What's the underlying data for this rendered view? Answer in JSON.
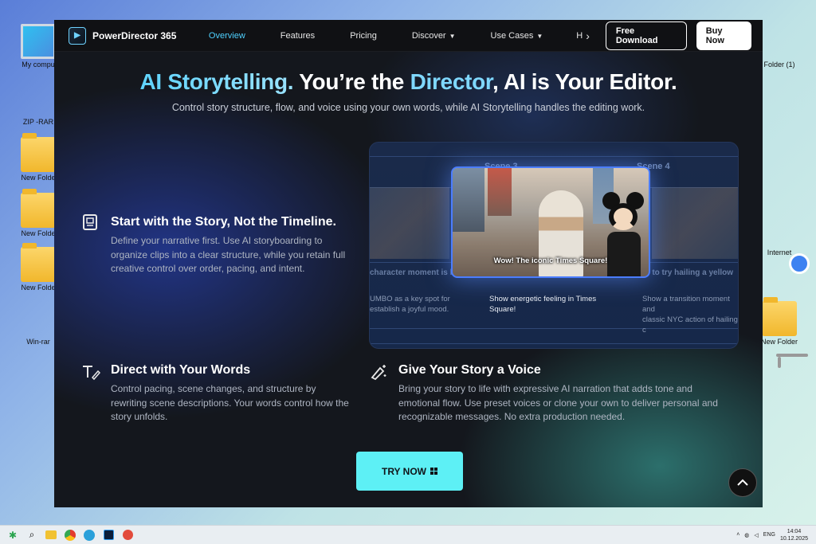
{
  "desktop": {
    "left_icons": [
      {
        "label": "My compu",
        "icon": "computer-icon"
      },
      {
        "label": "ZIP -RAR",
        "icon": "binders-icon"
      },
      {
        "label": "New Folde",
        "icon": "folder-icon"
      },
      {
        "label": "New Folde",
        "icon": "folder-icon"
      },
      {
        "label": "New Folde",
        "icon": "folder-icon"
      },
      {
        "label": "Win-rar",
        "icon": "winrar-icon"
      }
    ],
    "right_icons": [
      {
        "label": "Folder (1)",
        "icon": "binders-icon"
      },
      {
        "label": "Internet",
        "icon": "chrome-icon"
      },
      {
        "label": "New Folder",
        "icon": "folder-icon"
      },
      {
        "label": "",
        "icon": "recycle-bin-icon"
      }
    ]
  },
  "nav": {
    "brand": "PowerDirector 365",
    "links": [
      {
        "label": "Overview",
        "active": true
      },
      {
        "label": "Features"
      },
      {
        "label": "Pricing"
      },
      {
        "label": "Discover",
        "dropdown": true
      },
      {
        "label": "Use Cases",
        "dropdown": true
      },
      {
        "label": "H"
      }
    ],
    "arrow": "›",
    "free_download": "Free Download",
    "buy_now": "Buy Now"
  },
  "hero": {
    "title_part1": "AI Storytelling.",
    "title_part2": " You’re the ",
    "title_part3": "Director",
    "title_part4": ", AI is Your Editor.",
    "subtitle": "Control story structure, flow, and voice using your own words, while AI Storytelling handles the editing work."
  },
  "features": [
    {
      "title": "Start with the Story, Not the Timeline.",
      "desc": "Define your narrative first. Use AI storyboarding to organize clips into a clear structure, while you retain full creative control over order, pacing, and intent.",
      "icon": "storyboard-icon"
    },
    {
      "title": "Direct with Your Words",
      "desc": "Control pacing, scene changes, and structure by rewriting scene descriptions. Your words control how the story unfolds.",
      "icon": "text-edit-icon"
    },
    {
      "title": "Give Your Story a Voice",
      "desc": "Bring your story to life with expressive AI narration that adds tone and emotional flow. Use preset voices or clone your own to deliver personal and recognizable messages. No extra production needed.",
      "icon": "voice-pen-icon"
    }
  ],
  "preview": {
    "scene_left": "Scene 3",
    "scene_right": "Scene 4",
    "main_caption": "Wow! The iconic Times Square!",
    "strip_left_caption": "character moment is h",
    "strip_right_caption": "e to try hailing a yellow",
    "desc_left": "UMBO as a key spot for\nestablish a joyful mood.",
    "desc_main": "Show energetic feeling in Times\nSquare!",
    "desc_right": "Show a transition moment and\nclassic NYC action of hailing c"
  },
  "cta": {
    "label": "TRY NOW"
  },
  "taskbar": {
    "lang": "ENG",
    "time": "14:04",
    "date": "10.12.2025"
  }
}
